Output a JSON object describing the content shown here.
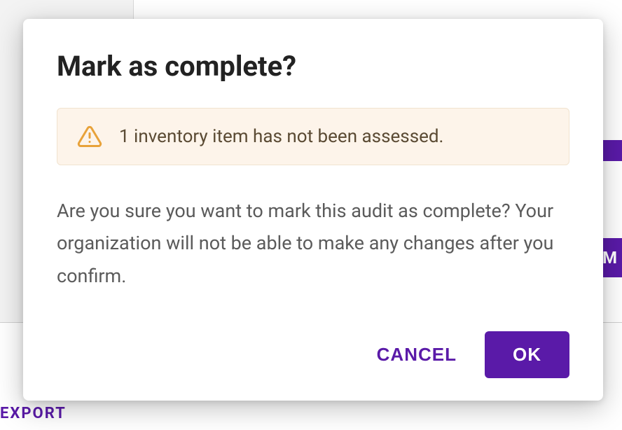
{
  "background": {
    "top_text_fragment": "",
    "right_button_fragment": "M",
    "export_label_fragment": "EXPORT"
  },
  "dialog": {
    "title": "Mark as complete?",
    "warning": {
      "icon": "warning-triangle-icon",
      "text": "1 inventory item has not been assessed."
    },
    "body": "Are you sure you want to mark this audit as complete? Your organization will not be able to make any changes after you confirm.",
    "actions": {
      "cancel_label": "CANCEL",
      "ok_label": "OK"
    }
  },
  "colors": {
    "accent": "#5a1aa8",
    "warning_bg": "#fdf4ea",
    "warning_border": "#f1e3cf",
    "warning_icon": "#e8a23a"
  }
}
